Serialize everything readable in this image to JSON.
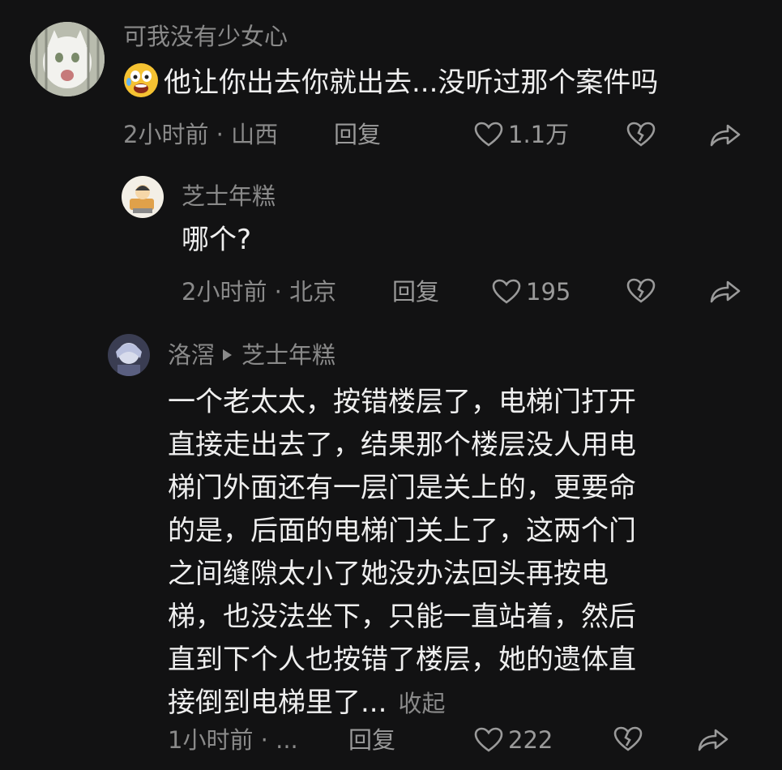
{
  "comments": [
    {
      "username": "可我没有少女心",
      "emoji_icon": "shocked-face-emoji",
      "text": "他让你出去你就出去...没听过那个案件吗",
      "time_location": "2小时前 · 山西",
      "reply_label": "回复",
      "likes": "1.1万"
    },
    {
      "username": "芝士年糕",
      "text": "哪个?",
      "time_location": "2小时前 · 北京",
      "reply_label": "回复",
      "likes": "195"
    },
    {
      "username": "洛滘",
      "reply_to": "芝士年糕",
      "lines": [
        "一个老太太，按错楼层了，电梯门打开",
        "直接走出去了，结果那个楼层没人用电",
        "梯门外面还有一层门是关上的，更要命",
        "的是，后面的电梯门关上了，这两个门",
        "之间缝隙太小了她没办法回头再按电",
        "梯，也没法坐下，只能一直站着，然后",
        "直到下个人也按错了楼层，她的遗体直",
        "接倒到电梯里了..."
      ],
      "collapse_label": "收起",
      "time_location": "1小时前 · ...",
      "reply_label": "回复",
      "likes": "222"
    }
  ],
  "icons": {
    "like": "heart-outline-icon",
    "dislike": "broken-heart-icon",
    "share": "share-arrow-icon"
  },
  "colors": {
    "background": "#121213",
    "primary_text": "#efefef",
    "secondary_text": "#8a8a8a"
  }
}
